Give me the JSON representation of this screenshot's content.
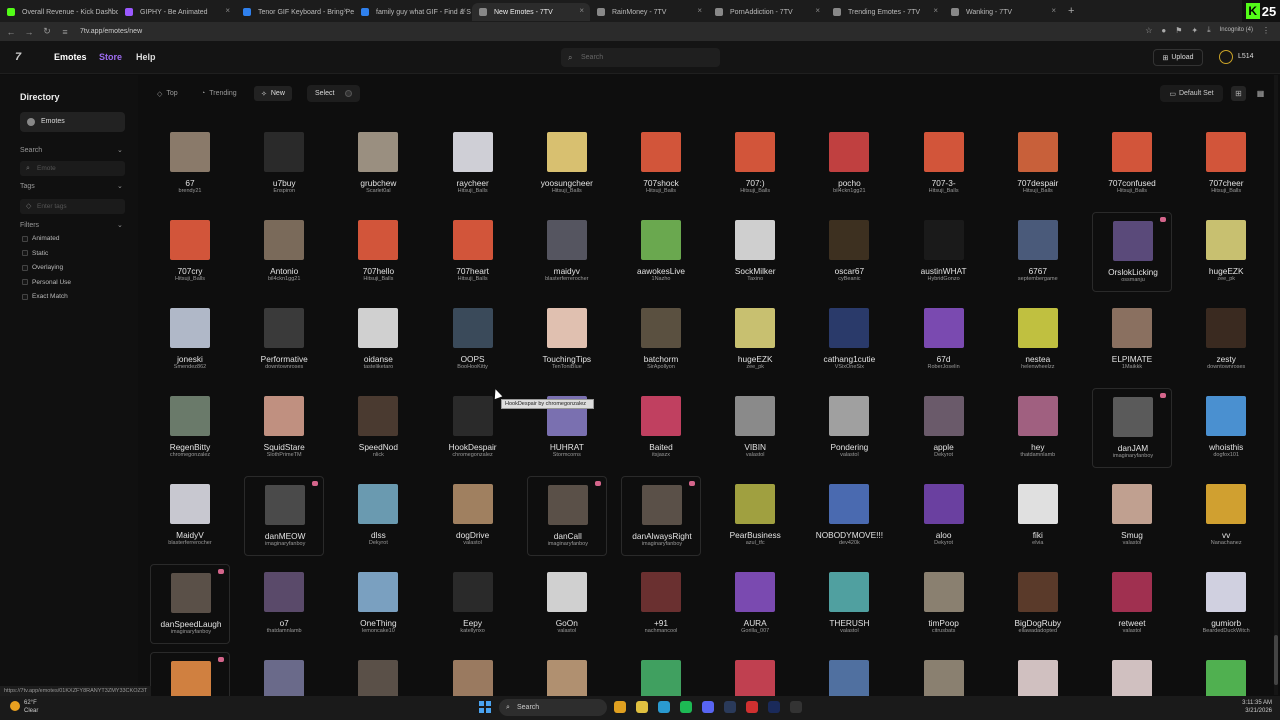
{
  "browser": {
    "tabs": [
      {
        "title": "Overall Revenue - Kick Dashboa",
        "fav": "#53fc18",
        "active": false
      },
      {
        "title": "GIPHY - Be Animated",
        "fav": "#9b59ff",
        "active": false
      },
      {
        "title": "Tenor GIF Keyboard - Bring Per",
        "fav": "#2f80ed",
        "active": false
      },
      {
        "title": "family guy what GIF - Find & S",
        "fav": "#2f80ed",
        "active": false
      },
      {
        "title": "New Emotes - 7TV",
        "fav": "#888888",
        "active": true
      },
      {
        "title": "RainMoney - 7TV",
        "fav": "#888888",
        "active": false
      },
      {
        "title": "PornAddiction - 7TV",
        "fav": "#888888",
        "active": false
      },
      {
        "title": "Trending Emotes - 7TV",
        "fav": "#888888",
        "active": false
      },
      {
        "title": "Wanking - 7TV",
        "fav": "#888888",
        "active": false
      }
    ],
    "new_tab": "+",
    "kick_badge": "25",
    "url": "7tv.app/emotes/new",
    "incognito_label": "Incognito (4)",
    "status_url": "https://7tv.app/emotes/01KXZFY8RANYT3ZMY33CKOZ3T"
  },
  "site": {
    "logo": "7",
    "nav": [
      "Emotes",
      "Store",
      "Help"
    ],
    "search_placeholder": "Search",
    "upload_label": "Upload",
    "user_value": "L514"
  },
  "sidebar": {
    "title": "Directory",
    "emotes_label": "Emotes",
    "search_label": "Search",
    "search_placeholder": "Emote",
    "tags_label": "Tags",
    "tags_placeholder": "Enter tags",
    "filters_label": "Filters",
    "filters": [
      "Animated",
      "Static",
      "Overlaying",
      "Personal Use",
      "Exact Match"
    ]
  },
  "toolbar": {
    "sort": [
      "Top",
      "Trending",
      "New"
    ],
    "active_sort": "New",
    "select_label": "Select",
    "default_set_label": "Default Set"
  },
  "tooltip": "HookDespair by chromegonzalez",
  "emotes": [
    {
      "name": "67",
      "author": "brendy21",
      "color": "#8a7a6a"
    },
    {
      "name": "u7buy",
      "author": "Enspiron",
      "color": "#2a2a2a"
    },
    {
      "name": "grubchew",
      "author": "Scarlet0al",
      "color": "#9a8f80"
    },
    {
      "name": "raycheer",
      "author": "Hitsuji_Balls",
      "color": "#cfcfd6"
    },
    {
      "name": "yoosungcheer",
      "author": "Hitsuji_Balls",
      "color": "#d8c070"
    },
    {
      "name": "707shock",
      "author": "Hitsuji_Balls",
      "color": "#d2553a"
    },
    {
      "name": "707:)",
      "author": "Hitsuji_Balls",
      "color": "#d2553a"
    },
    {
      "name": "pocho",
      "author": "bil4ckn1gg21",
      "color": "#c04040"
    },
    {
      "name": "707-3-",
      "author": "Hitsuji_Balls",
      "color": "#d2553a"
    },
    {
      "name": "707despair",
      "author": "Hitsuji_Balls",
      "color": "#c8603a"
    },
    {
      "name": "707confused",
      "author": "Hitsuji_Balls",
      "color": "#d2553a"
    },
    {
      "name": "707cheer",
      "author": "Hitsuji_Balls",
      "color": "#d2553a"
    },
    {
      "name": "707cry",
      "author": "Hitsuji_Balls",
      "color": "#d2553a"
    },
    {
      "name": "Antonio",
      "author": "bil4ckn1gg21",
      "color": "#7a6a5a"
    },
    {
      "name": "707hello",
      "author": "Hitsuji_Balls",
      "color": "#d2553a"
    },
    {
      "name": "707heart",
      "author": "Hitsuji_Balls",
      "color": "#d2553a"
    },
    {
      "name": "maidyv",
      "author": "blasterferrerocher",
      "color": "#555560"
    },
    {
      "name": "aawokesLive",
      "author": "1Nazho",
      "color": "#6aa84f"
    },
    {
      "name": "SockMilker",
      "author": "Taxino",
      "color": "#cfcfcf"
    },
    {
      "name": "oscar67",
      "author": "cyBeanic",
      "color": "#3d3020"
    },
    {
      "name": "austinWHAT",
      "author": "HybridGonzo",
      "color": "#1a1a1a"
    },
    {
      "name": "6767",
      "author": "septembergame",
      "color": "#4a5a7a"
    },
    {
      "name": "OrslokLicking",
      "author": "ossmanju",
      "color": "#5a4a7a",
      "boxed": true
    },
    {
      "name": "hugeEZK",
      "author": "zee_pk",
      "color": "#c8c070"
    },
    {
      "name": "joneski",
      "author": "Smendez862",
      "color": "#b0b8c8"
    },
    {
      "name": "Performative",
      "author": "downtownroses",
      "color": "#3a3a3a"
    },
    {
      "name": "oidanse",
      "author": "tasteliketaro",
      "color": "#d0d0d0"
    },
    {
      "name": "OOPS",
      "author": "BooHooKitty",
      "color": "#3a4a5a"
    },
    {
      "name": "TouchingTips",
      "author": "TenToniBlue",
      "color": "#e0c0b0"
    },
    {
      "name": "batchorm",
      "author": "SirApollyon",
      "color": "#5a5040"
    },
    {
      "name": "hugeEZK",
      "author": "zee_pk",
      "color": "#c8c070"
    },
    {
      "name": "cathang1cutie",
      "author": "VSixOneSix",
      "color": "#2a3a6a"
    },
    {
      "name": "67d",
      "author": "RoberJoselin",
      "color": "#7a4ab0"
    },
    {
      "name": "nestea",
      "author": "helenwheelzz",
      "color": "#c0c040"
    },
    {
      "name": "ELPIMATE",
      "author": "1Maikkk",
      "color": "#8a7060"
    },
    {
      "name": "zesty",
      "author": "downtownroses",
      "color": "#3a2a20"
    },
    {
      "name": "RegenBitty",
      "author": "chromegonzalez",
      "color": "#6a7a6a"
    },
    {
      "name": "SquidStare",
      "author": "SlothPrimeTM",
      "color": "#c09080"
    },
    {
      "name": "SpeedNod",
      "author": "nlick",
      "color": "#4a3a30"
    },
    {
      "name": "HookDespair",
      "author": "chromegonzalez",
      "color": "#2a2a2a"
    },
    {
      "name": "HUHRAT",
      "author": "Stormcorns",
      "color": "#7a70b0"
    },
    {
      "name": "Baited",
      "author": "itsjaszx",
      "color": "#c04060"
    },
    {
      "name": "VIBIN",
      "author": "valastol",
      "color": "#8a8a8a"
    },
    {
      "name": "Pondering",
      "author": "valastol",
      "color": "#a0a0a0"
    },
    {
      "name": "apple",
      "author": "Dekyrot",
      "color": "#6a5a6a"
    },
    {
      "name": "hey",
      "author": "thatdamnlamb",
      "color": "#a06080"
    },
    {
      "name": "danJAM",
      "author": "imaginaryfanboy",
      "color": "#5a5a5a",
      "boxed": true
    },
    {
      "name": "whoisthis",
      "author": "dogfox101",
      "color": "#4a90d0"
    },
    {
      "name": "MaidyV",
      "author": "blasterferrerocher",
      "color": "#c8c8d0"
    },
    {
      "name": "danMEOW",
      "author": "imaginaryfanboy",
      "color": "#4a4a4a",
      "boxed": true
    },
    {
      "name": "dlss",
      "author": "Dekyrot",
      "color": "#6a9ab0"
    },
    {
      "name": "dogDrive",
      "author": "valastol",
      "color": "#a08060"
    },
    {
      "name": "danCall",
      "author": "imaginaryfanboy",
      "color": "#5a5048",
      "boxed": true
    },
    {
      "name": "danAlwaysRight",
      "author": "imaginaryfanboy",
      "color": "#5a5048",
      "boxed": true
    },
    {
      "name": "PearBusiness",
      "author": "azul_tfc",
      "color": "#a0a040"
    },
    {
      "name": "NOBODYMOVE!!!",
      "author": "dev420k",
      "color": "#4a6ab0"
    },
    {
      "name": "aloo",
      "author": "Dekyrot",
      "color": "#6a40a0"
    },
    {
      "name": "fiki",
      "author": "elvia",
      "color": "#e0e0e0"
    },
    {
      "name": "Smug",
      "author": "valastol",
      "color": "#c0a090"
    },
    {
      "name": "vv",
      "author": "Nanachanez",
      "color": "#d0a030"
    },
    {
      "name": "danSpeedLaugh",
      "author": "imaginaryfanboy",
      "color": "#5a5048",
      "boxed": true
    },
    {
      "name": "o7",
      "author": "thatdamnlamb",
      "color": "#5a4a6a"
    },
    {
      "name": "OneThing",
      "author": "lemoncake10",
      "color": "#7aa0c0"
    },
    {
      "name": "Eepy",
      "author": "katellynxo",
      "color": "#2a2a2a"
    },
    {
      "name": "GoOn",
      "author": "valastol",
      "color": "#d0d0d0"
    },
    {
      "name": "+91",
      "author": "nachmancool",
      "color": "#6a3030"
    },
    {
      "name": "AURA",
      "author": "Gorilla_007",
      "color": "#7a4ab0"
    },
    {
      "name": "THERUSH",
      "author": "valastol",
      "color": "#50a0a0"
    },
    {
      "name": "timPoop",
      "author": "citrusbats",
      "color": "#8a8070"
    },
    {
      "name": "BigDogRuby",
      "author": "ellawadadopted",
      "color": "#5a3a2a"
    },
    {
      "name": "retweet",
      "author": "valastol",
      "color": "#a03050"
    },
    {
      "name": "gumiorb",
      "author": "BeardedDuckWitch",
      "color": "#d0d0e0"
    },
    {
      "name": "",
      "author": "",
      "color": "#d08040",
      "boxed": true
    },
    {
      "name": "",
      "author": "",
      "color": "#6a6a8a"
    },
    {
      "name": "",
      "author": "",
      "color": "#5a5048"
    },
    {
      "name": "",
      "author": "",
      "color": "#9a7a60"
    },
    {
      "name": "",
      "author": "",
      "color": "#b09070"
    },
    {
      "name": "",
      "author": "",
      "color": "#40a060"
    },
    {
      "name": "",
      "author": "",
      "color": "#c04050"
    },
    {
      "name": "",
      "author": "",
      "color": "#5070a0"
    },
    {
      "name": "",
      "author": "",
      "color": "#8a8070"
    },
    {
      "name": "",
      "author": "",
      "color": "#d0c0c0"
    },
    {
      "name": "",
      "author": "",
      "color": "#d0c0c0"
    },
    {
      "name": "",
      "author": "",
      "color": "#50b050"
    }
  ],
  "taskbar": {
    "weather_temp": "62°F",
    "weather_desc": "Clear",
    "search_label": "Search",
    "time": "3:11:35 AM",
    "date": "3/21/2026",
    "icons": [
      {
        "name": "chrome-icon",
        "color": "#e0a020"
      },
      {
        "name": "explorer-icon",
        "color": "#e0c040"
      },
      {
        "name": "edge-icon",
        "color": "#2a9ad0"
      },
      {
        "name": "spotify-icon",
        "color": "#1db954"
      },
      {
        "name": "discord-icon",
        "color": "#5865f2"
      },
      {
        "name": "steam-icon",
        "color": "#2a3a5a"
      },
      {
        "name": "app-red-icon",
        "color": "#d03030"
      },
      {
        "name": "photoshop-icon",
        "color": "#1a2a5a"
      },
      {
        "name": "terminal-icon",
        "color": "#333333"
      }
    ]
  }
}
